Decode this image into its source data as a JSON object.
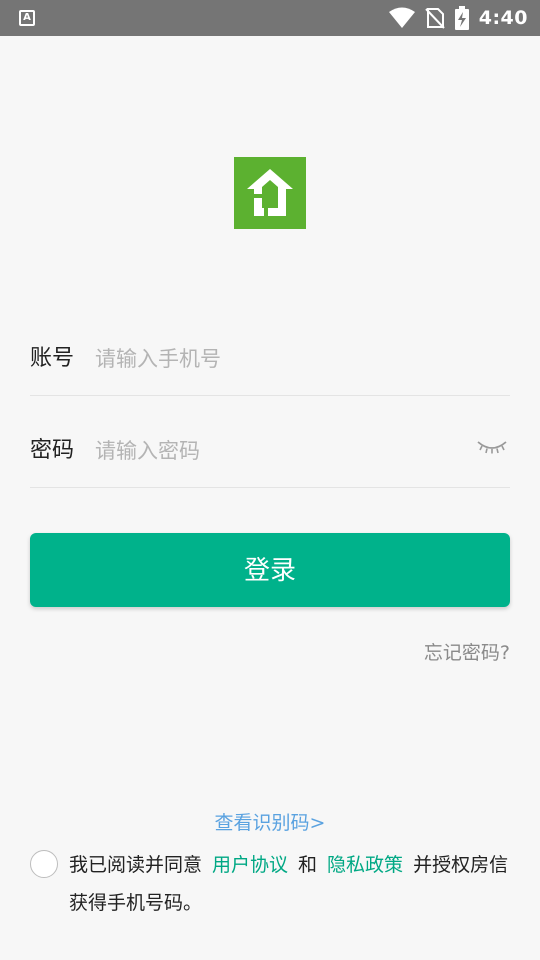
{
  "status_bar": {
    "app_icon_letter": "A",
    "time": "4:40"
  },
  "login": {
    "account_label": "账号",
    "account_placeholder": "请输入手机号",
    "password_label": "密码",
    "password_placeholder": "请输入密码",
    "login_button": "登录",
    "forgot_password": "忘记密码?"
  },
  "footer": {
    "view_code": "查看识别码>",
    "agree_prefix": "我已阅读并同意",
    "user_agreement": "用户协议",
    "and": "和",
    "privacy_policy": "隐私政策",
    "agree_suffix": "并授权房信获得手机号码。"
  },
  "colors": {
    "brand_green": "#5cb130",
    "primary": "#00b28b",
    "link": "#00a884",
    "code_link": "#5aa2e0"
  }
}
